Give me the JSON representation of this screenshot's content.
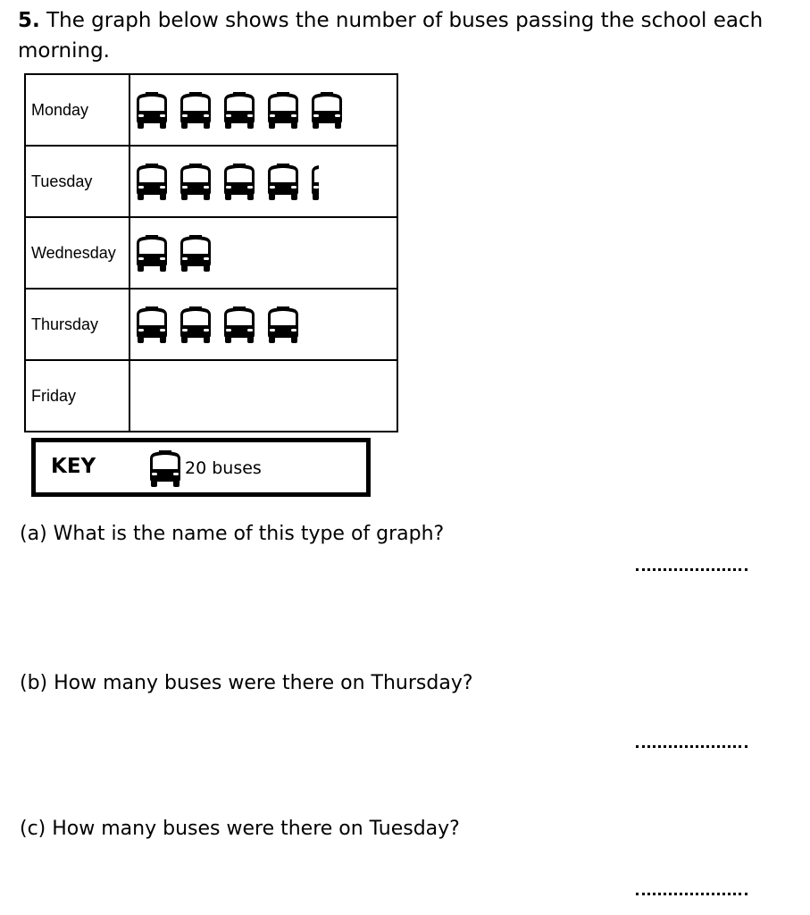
{
  "question": {
    "number": "5.",
    "text": "The graph below shows the number of buses passing the school each morning."
  },
  "chart_data": {
    "type": "pictogram",
    "icon": "bus-icon",
    "categories": [
      "Monday",
      "Tuesday",
      "Wednesday",
      "Thursday",
      "Friday"
    ],
    "icon_counts": [
      5,
      4.25,
      2,
      4,
      0
    ],
    "values": [
      100,
      85,
      40,
      80,
      0
    ],
    "key": {
      "label": "KEY",
      "text": "20 buses",
      "value_per_icon": 20
    }
  },
  "parts": [
    {
      "text": "(a) What is the name of this type of graph?",
      "answer": ""
    },
    {
      "text": "(b) How many buses were there on Thursday?",
      "answer": ""
    },
    {
      "text": "(c) How many buses were there on Tuesday?",
      "answer": ""
    }
  ]
}
